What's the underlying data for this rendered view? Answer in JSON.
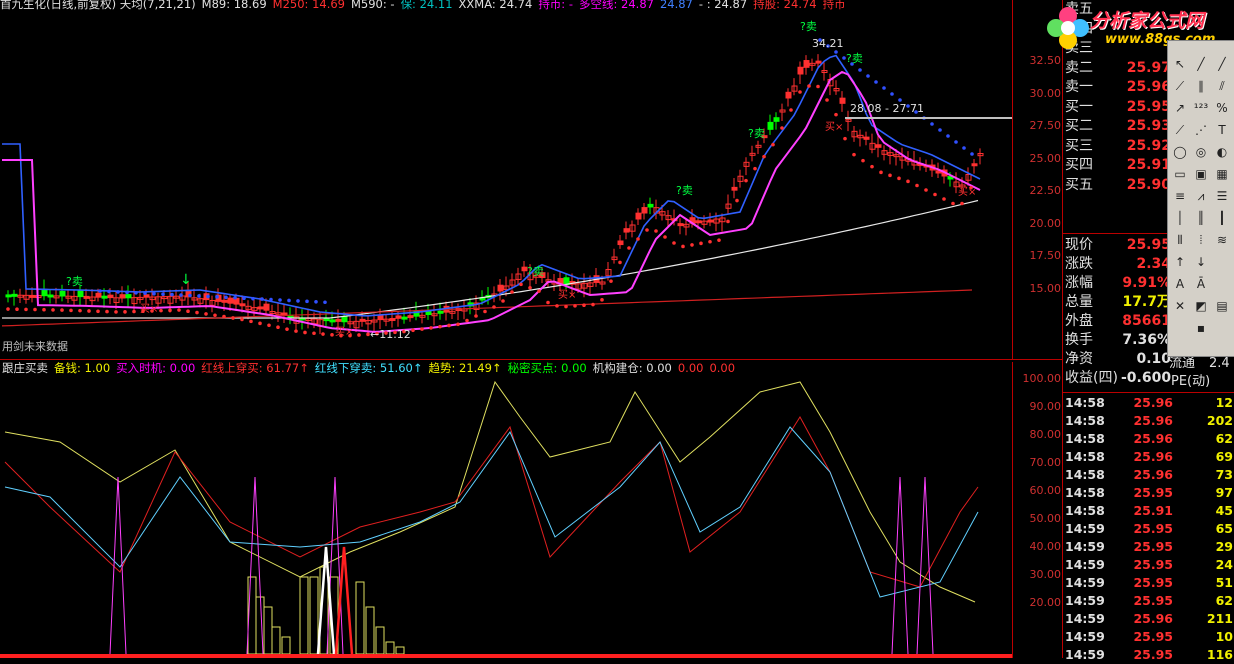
{
  "top_header": [
    {
      "text": "首九生化(日线,前复权) 天均(7,21,21)",
      "color": "#e0e0e0"
    },
    {
      "text": "M89: 18.69",
      "color": "#e0e0e0"
    },
    {
      "text": "M250: 14.69",
      "color": "#ff3030"
    },
    {
      "text": "M590: -",
      "color": "#e0e0e0"
    },
    {
      "text": "保: 24.11",
      "color": "#00c0c0"
    },
    {
      "text": "XXMA: 24.74",
      "color": "#e0e0e0"
    },
    {
      "text": "持币: -",
      "color": "#ff00ff"
    },
    {
      "text": "多空线: 24.87",
      "color": "#ff00ff"
    },
    {
      "text": "24.87",
      "color": "#4080ff"
    },
    {
      "text": "- : 24.87",
      "color": "#e0e0e0"
    },
    {
      "text": "持股: 24.74",
      "color": "#ff3030"
    },
    {
      "text": "持币",
      "color": "#ff3030"
    }
  ],
  "bot_header": [
    {
      "text": "跟庄买卖",
      "color": "#e0e0e0"
    },
    {
      "text": "备钱: 1.00",
      "color": "#f0f000"
    },
    {
      "text": "买入时机: 0.00",
      "color": "#ff00ff"
    },
    {
      "text": "红线上穿买: 61.77↑",
      "color": "#ff3030"
    },
    {
      "text": "红线下穿卖: 51.60↑",
      "color": "#40e0ff"
    },
    {
      "text": "趋势: 21.49↑",
      "color": "#f0f000"
    },
    {
      "text": "秘密买点: 0.00",
      "color": "#00ff00"
    },
    {
      "text": "机构建仓: 0.00",
      "color": "#e0e0e0"
    },
    {
      "text": "0.00",
      "color": "#ff3030"
    },
    {
      "text": "0.00",
      "color": "#ff3030"
    }
  ],
  "status_text": "用剑未来数据",
  "logo": {
    "title": "分析家公式网",
    "url": "www.88gs.com"
  },
  "chart_labels": {
    "high_label": "34.21",
    "low_label": "11.12",
    "range_label": "28.08 - 27.71",
    "sell_tag": "?卖",
    "buy_tag": "买×"
  },
  "colors": {
    "up": "#ff3030",
    "down": "#00ff00",
    "axis": "#b00000",
    "white_line": "#ffffff",
    "blue_line": "#3060ff",
    "magenta": "#ff00ff",
    "yellow": "#f0f000",
    "cyan": "#40e0ff"
  },
  "top_axis": {
    "ticks": [
      "32.50",
      "30.00",
      "27.50",
      "25.00",
      "22.50",
      "20.00",
      "17.50",
      "15.00"
    ]
  },
  "bot_axis": {
    "ticks": [
      "100.00",
      "90.00",
      "80.00",
      "70.00",
      "60.00",
      "50.00",
      "40.00",
      "30.00",
      "20.00"
    ]
  },
  "order_book": [
    {
      "label": "卖五",
      "value": "",
      "color": "#ff3030"
    },
    {
      "label": "卖四",
      "value": "",
      "color": "#ff3030"
    },
    {
      "label": "卖三",
      "value": "",
      "color": "#ff3030"
    },
    {
      "label": "卖二",
      "value": "25.97",
      "color": "#ff3030"
    },
    {
      "label": "卖一",
      "value": "25.96",
      "color": "#ff3030"
    },
    {
      "label": "买一",
      "value": "25.95",
      "color": "#ff3030"
    },
    {
      "label": "买二",
      "value": "25.93",
      "color": "#ff3030"
    },
    {
      "label": "买三",
      "value": "25.92",
      "color": "#ff3030"
    },
    {
      "label": "买四",
      "value": "25.91",
      "color": "#ff3030"
    },
    {
      "label": "买五",
      "value": "25.90",
      "color": "#ff3030"
    }
  ],
  "quote": [
    {
      "label": "现价",
      "value": "25.95",
      "color": "#ff3030"
    },
    {
      "label": "涨跌",
      "value": "2.34",
      "color": "#ff3030"
    },
    {
      "label": "涨幅",
      "value": "9.91%",
      "color": "#ff3030"
    },
    {
      "label": "总量",
      "value": "17.7万",
      "color": "#f0f000"
    },
    {
      "label": "外盘",
      "value": "85661",
      "color": "#ff3030"
    },
    {
      "label": "换手",
      "value": "7.36%",
      "color": "#e0e0e0"
    },
    {
      "label": "净资",
      "value": "0.10",
      "color": "#e0e0e0"
    },
    {
      "label": "收益(四)",
      "value": "-0.600",
      "color": "#e0e0e0"
    }
  ],
  "quote_extra": {
    "liutong": "流通",
    "liutong_val": "2.4",
    "pe": "PE(动)"
  },
  "ticks": [
    {
      "time": "14:58",
      "price": "25.96",
      "vol": "12"
    },
    {
      "time": "14:58",
      "price": "25.96",
      "vol": "202"
    },
    {
      "time": "14:58",
      "price": "25.96",
      "vol": "62"
    },
    {
      "time": "14:58",
      "price": "25.96",
      "vol": "69"
    },
    {
      "time": "14:58",
      "price": "25.96",
      "vol": "73"
    },
    {
      "time": "14:58",
      "price": "25.95",
      "vol": "97"
    },
    {
      "time": "14:58",
      "price": "25.91",
      "vol": "45"
    },
    {
      "time": "14:59",
      "price": "25.95",
      "vol": "65"
    },
    {
      "time": "14:59",
      "price": "25.95",
      "vol": "29"
    },
    {
      "time": "14:59",
      "price": "25.95",
      "vol": "24"
    },
    {
      "time": "14:59",
      "price": "25.95",
      "vol": "51"
    },
    {
      "time": "14:59",
      "price": "25.95",
      "vol": "62"
    },
    {
      "time": "14:59",
      "price": "25.96",
      "vol": "211"
    },
    {
      "time": "14:59",
      "price": "25.95",
      "vol": "10"
    },
    {
      "time": "14:59",
      "price": "25.95",
      "vol": "116"
    }
  ]
}
